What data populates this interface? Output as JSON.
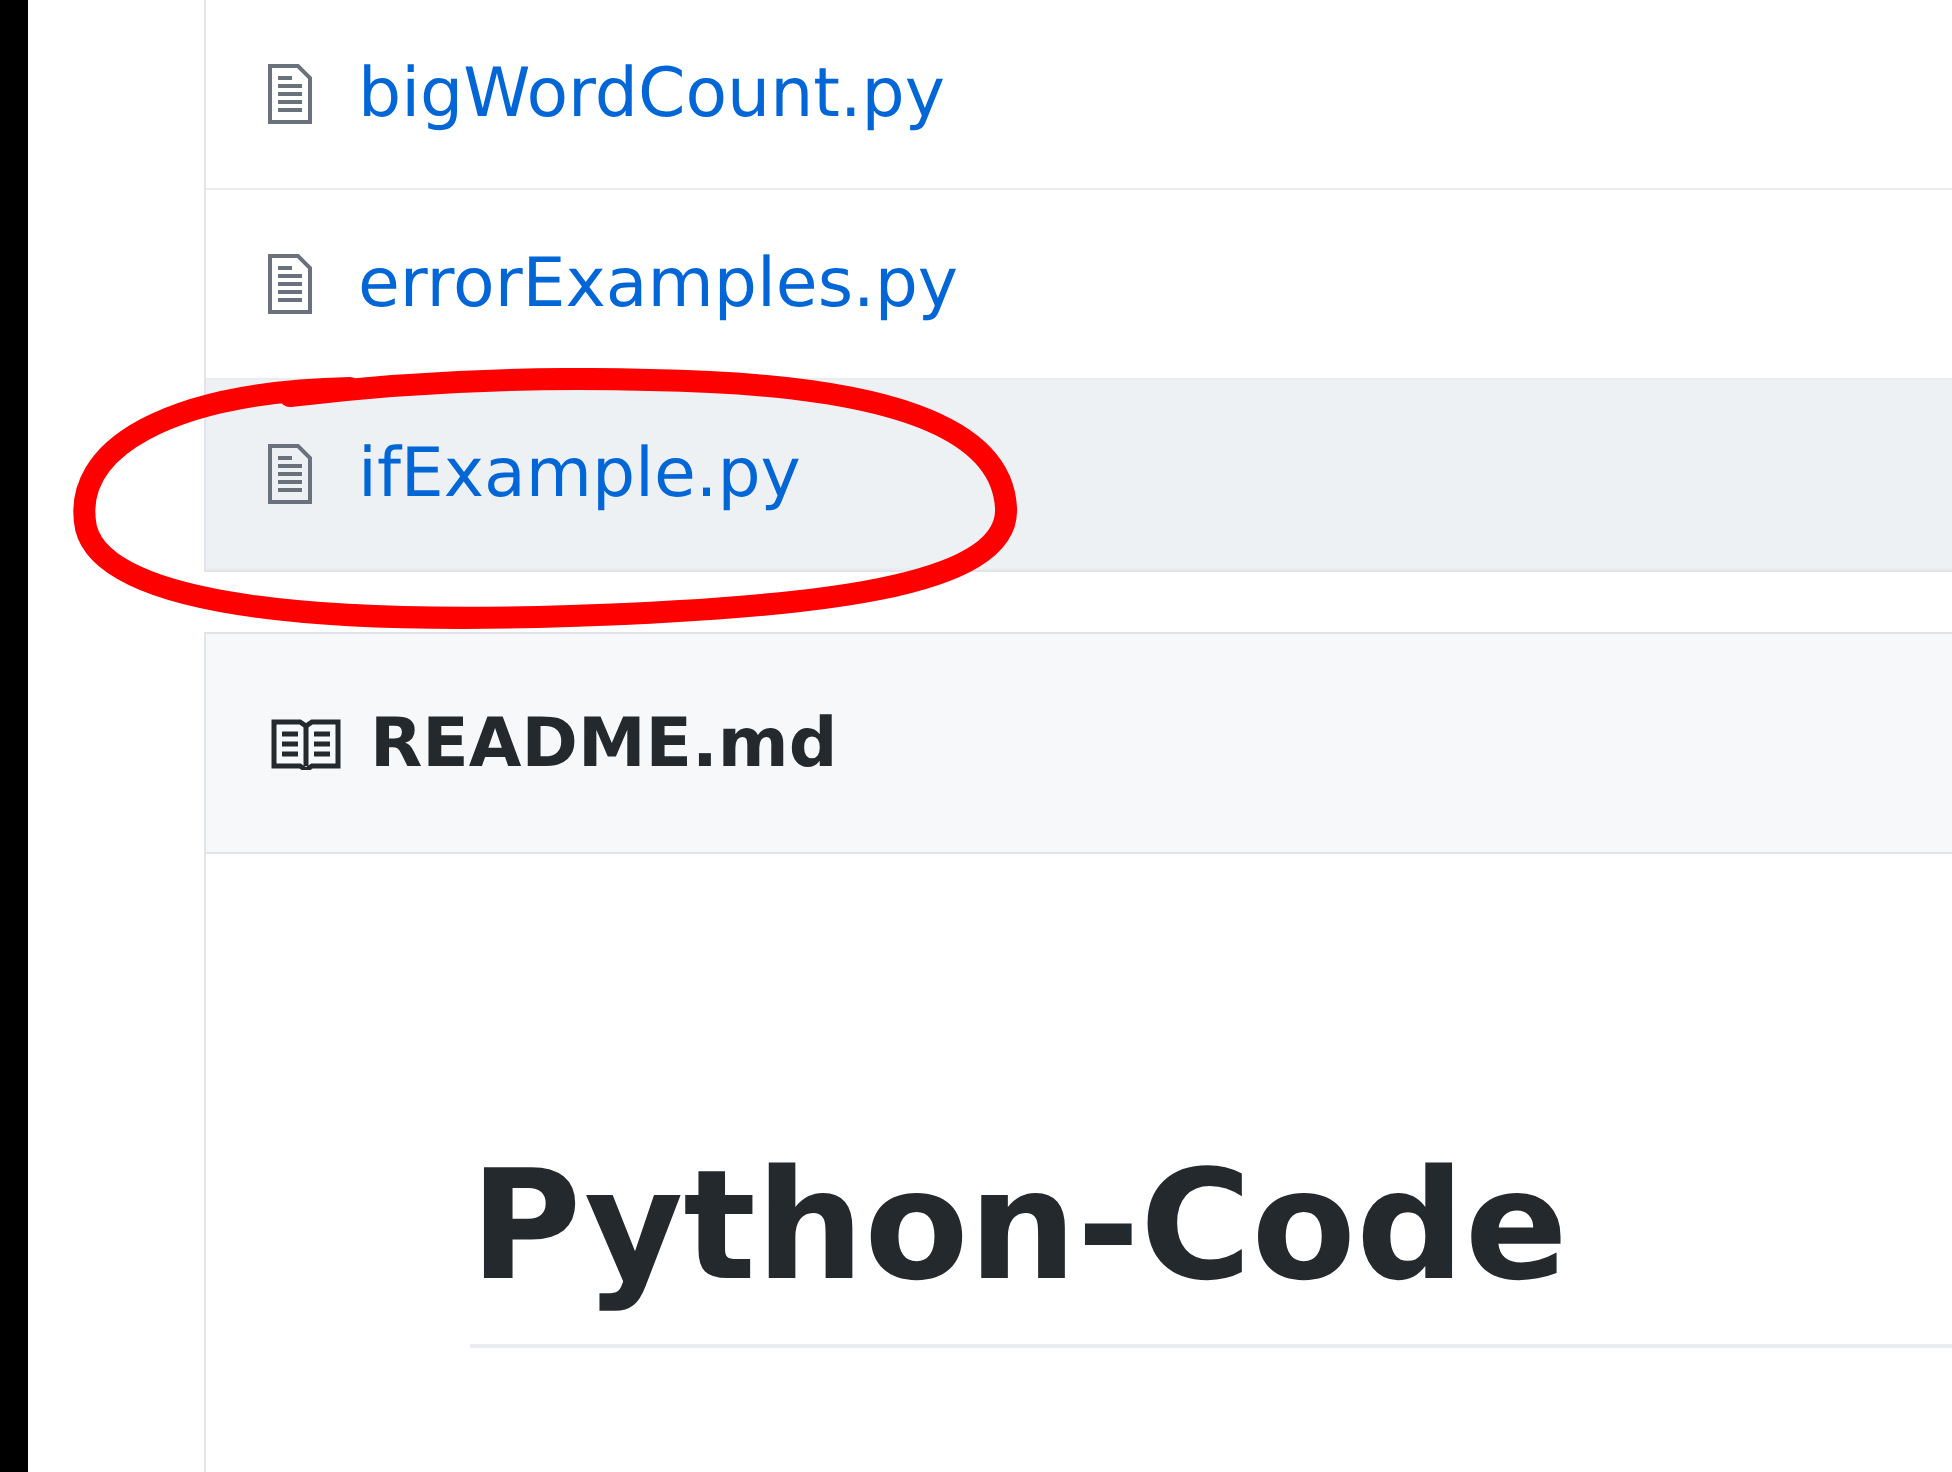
{
  "files": [
    {
      "name": "bigWordCount.py",
      "highlighted": false
    },
    {
      "name": "errorExamples.py",
      "highlighted": false
    },
    {
      "name": "ifExample.py",
      "highlighted": true,
      "circled": true
    }
  ],
  "readme": {
    "filename": "README.md",
    "heading": "Python-Code"
  }
}
